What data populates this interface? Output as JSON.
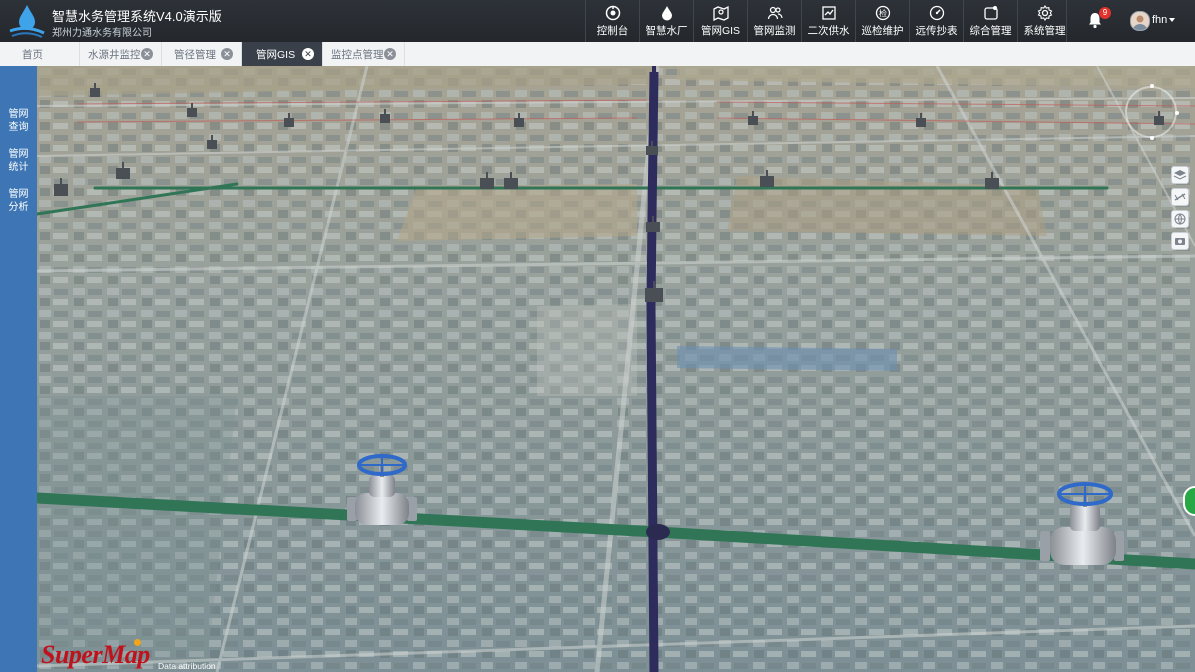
{
  "header": {
    "title": "智慧水务管理系统V4.0演示版",
    "subtitle": "郑州力通水务有限公司",
    "nav": [
      {
        "label": "控制台",
        "icon": "dashboard-icon"
      },
      {
        "label": "智慧水厂",
        "icon": "water-drop-icon"
      },
      {
        "label": "管网GIS",
        "icon": "map-icon"
      },
      {
        "label": "管网监测",
        "icon": "users-icon"
      },
      {
        "label": "二次供水",
        "icon": "water-supply-icon"
      },
      {
        "label": "巡检维护",
        "icon": "inspection-icon"
      },
      {
        "label": "远传抄表",
        "icon": "meter-icon"
      },
      {
        "label": "综合管理",
        "icon": "management-icon"
      },
      {
        "label": "系统管理",
        "icon": "gear-icon"
      }
    ],
    "notification_count": "9",
    "username": "fhn"
  },
  "tabs": [
    {
      "label": "首页",
      "closable": false,
      "active": false
    },
    {
      "label": "水源井监控",
      "closable": true,
      "active": false
    },
    {
      "label": "管径管理",
      "closable": true,
      "active": false
    },
    {
      "label": "管网GIS",
      "closable": true,
      "active": true
    },
    {
      "label": "监控点管理",
      "closable": true,
      "active": false
    }
  ],
  "sidebar": {
    "items": [
      {
        "line1": "管网",
        "line2": "查询"
      },
      {
        "line1": "管网",
        "line2": "统计"
      },
      {
        "line1": "管网",
        "line2": "分析"
      }
    ]
  },
  "map": {
    "brand": "SuperMap",
    "attribution": "Data attribution",
    "right_controls": [
      "layers-icon",
      "measure-icon",
      "globe-icon",
      "camera-icon"
    ],
    "green_control": "green-status-icon"
  },
  "colors": {
    "sidebar": "#3e76b5",
    "header": "#2d3238",
    "main_pipe": "#2e2c5c",
    "branch_pipe": "#2f7556",
    "valve_wheel": "#2f69c9"
  }
}
